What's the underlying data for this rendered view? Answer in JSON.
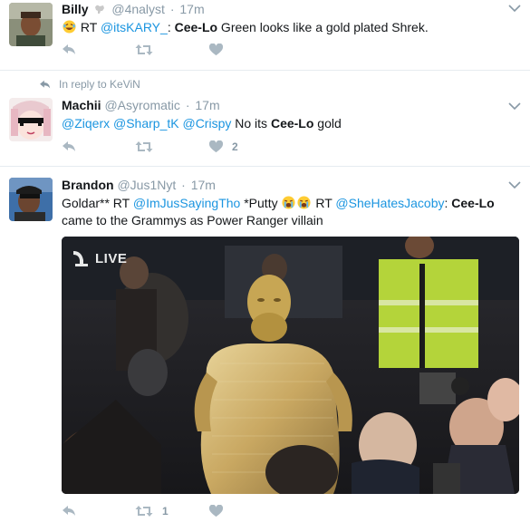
{
  "tweets": [
    {
      "name": "Billy",
      "name_emoji": "goat-emoji",
      "handle": "@4nalyst",
      "sep": "·",
      "time": "17m",
      "text_pre": "RT ",
      "mention": "@itsKARY_",
      "colon": ":",
      "bold": "Cee-Lo",
      "text_post": " Green looks like a gold plated Shrek."
    },
    {
      "reply_context": "In reply to KeViN",
      "name": "Machii",
      "handle": "@Asyromatic",
      "sep": "·",
      "time": "17m",
      "mention1": "@Ziqerx",
      "mention2": "@Sharp_tK",
      "mention3": "@Crispy",
      "text_mid": " No its ",
      "bold": "Cee-Lo",
      "text_post": " gold",
      "like_count": "2"
    },
    {
      "name": "Brandon",
      "handle": "@Jus1Nyt",
      "sep": "·",
      "time": "17m",
      "text_a": "Goldar** RT ",
      "mention1": "@ImJusSayingTho",
      "text_b": " *Putty ",
      "text_c": " RT ",
      "mention2": "@SheHatesJacoby",
      "colon": ":",
      "bold": "Cee-Lo",
      "text_d": "came to the Grammys as Power Ranger villain",
      "media_badge": "LIVE",
      "retweet_count": "1"
    }
  ],
  "colors": {
    "link": "#1b95e0",
    "muted": "#8899a6",
    "divider": "#e6ecf0",
    "icon": "#aab8c2"
  }
}
